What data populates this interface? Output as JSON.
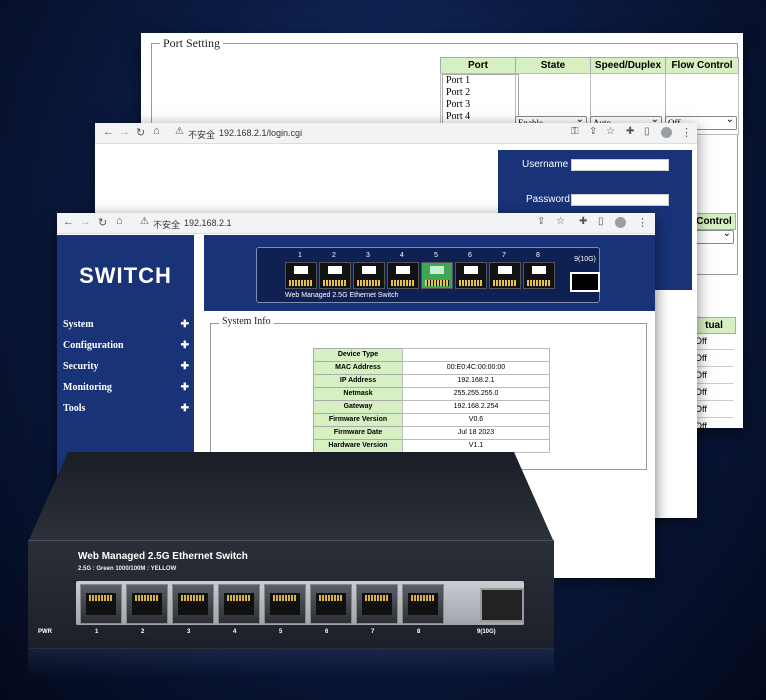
{
  "port_setting": {
    "legend": "Port Setting",
    "columns": [
      "Port",
      "State",
      "Speed/Duplex",
      "Flow Control"
    ],
    "port_list": [
      "Port 1",
      "Port 2",
      "Port 3",
      "Port 4"
    ],
    "state_value": "Enable",
    "speed_value": "Auto",
    "flow_value": "Off",
    "flow_control_header_2": "Control",
    "actual_header": "tual",
    "actual_values": [
      "Off",
      "Off",
      "Off",
      "Off",
      "Off",
      "Off"
    ]
  },
  "login_window": {
    "url_warning": "不安全",
    "url": "192.168.2.1/login.cgi",
    "username_label": "Username",
    "password_label": "Password"
  },
  "switch_window": {
    "url_warning": "不安全",
    "url": "192.168.2.1",
    "brand": "SWITCH",
    "nav": [
      {
        "label": "System"
      },
      {
        "label": "Configuration"
      },
      {
        "label": "Security"
      },
      {
        "label": "Monitoring"
      },
      {
        "label": "Tools"
      }
    ],
    "nav_expand_icon": "plus-icon",
    "panel_ports": [
      "1",
      "2",
      "3",
      "4",
      "5",
      "6",
      "7",
      "8"
    ],
    "active_port": "5",
    "sfp_label": "9(10G)",
    "panel_caption": "Web Managed 2.5G Ethernet Switch",
    "system_info_legend": "System Info",
    "system_info": [
      {
        "key": "Device Type",
        "value": ""
      },
      {
        "key": "MAC Address",
        "value": "00:E0:4C:00:00:00"
      },
      {
        "key": "IP Address",
        "value": "192.168.2.1"
      },
      {
        "key": "Netmask",
        "value": "255.255.255.0"
      },
      {
        "key": "Gateway",
        "value": "192.168.2.254"
      },
      {
        "key": "Firmware Version",
        "value": "V0.6"
      },
      {
        "key": "Firmware Date",
        "value": "Jul 18 2023"
      },
      {
        "key": "Hardware Version",
        "value": "V1.1"
      }
    ]
  },
  "device": {
    "title": "Web Managed 2.5G Ethernet Switch",
    "subtitle": "2.5G : Green     1000/100M : YELLOW",
    "pwr_label": "PWR",
    "port_labels": [
      "1",
      "2",
      "3",
      "4",
      "5",
      "6",
      "7",
      "8"
    ],
    "sfp_label": "9(10G)"
  },
  "colors": {
    "nav_blue": "#183377",
    "header_green": "#d6f0c2",
    "active_port_green": "#3fa653"
  }
}
